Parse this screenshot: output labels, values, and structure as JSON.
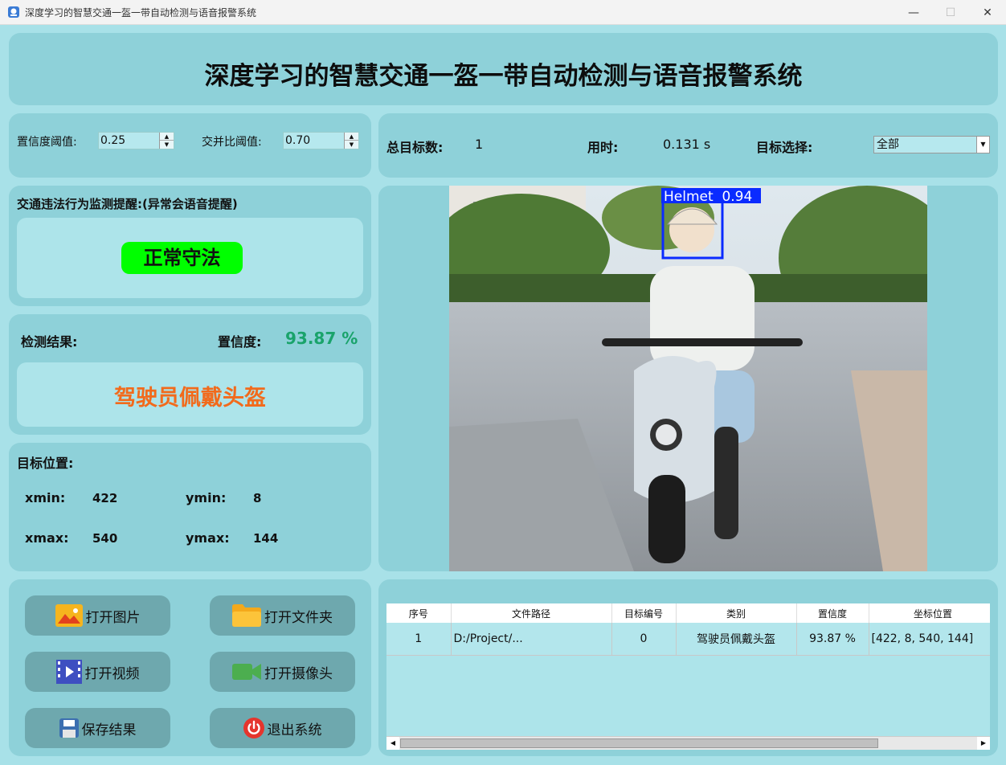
{
  "window": {
    "title": "深度学习的智慧交通一盔一带自动检测与语音报警系统"
  },
  "header": {
    "title": "深度学习的智慧交通一盔一带自动检测与语音报警系统"
  },
  "params": {
    "conf_label": "置信度阈值:",
    "conf_value": "0.25",
    "iou_label": "交并比阈值:",
    "iou_value": "0.70"
  },
  "stats": {
    "total_label": "总目标数:",
    "total_value": "1",
    "time_label": "用时:",
    "time_value": "0.131 s",
    "select_label": "目标选择:",
    "select_value": "全部"
  },
  "alert": {
    "title": "交通违法行为监测提醒:(异常会语音提醒)",
    "status": "正常守法",
    "status_color": "#00ff00"
  },
  "result": {
    "label": "检测结果:",
    "conf_label": "置信度:",
    "conf_value": "93.87 %",
    "class_text": "驾驶员佩戴头盔",
    "class_color": "#f26a1b",
    "conf_color": "#1aa36b"
  },
  "position": {
    "title": "目标位置:",
    "xmin_label": "xmin:",
    "xmin_value": "422",
    "ymin_label": "ymin:",
    "ymin_value": "8",
    "xmax_label": "xmax:",
    "xmax_value": "540",
    "ymax_label": "ymax:",
    "ymax_value": "144"
  },
  "detection": {
    "box_label": "Helmet  0.94",
    "box_color": "#0a2bff"
  },
  "buttons": {
    "open_image": "打开图片",
    "open_folder": "打开文件夹",
    "open_video": "打开视频",
    "open_camera": "打开摄像头",
    "save": "保存结果",
    "exit": "退出系统"
  },
  "table": {
    "headers": [
      "序号",
      "文件路径",
      "目标编号",
      "类别",
      "置信度",
      "坐标位置"
    ],
    "rows": [
      [
        "1",
        "D:/Project/...",
        "0",
        "驾驶员佩戴头盔",
        "93.87 %",
        "[422, 8, 540, 144]"
      ]
    ]
  }
}
